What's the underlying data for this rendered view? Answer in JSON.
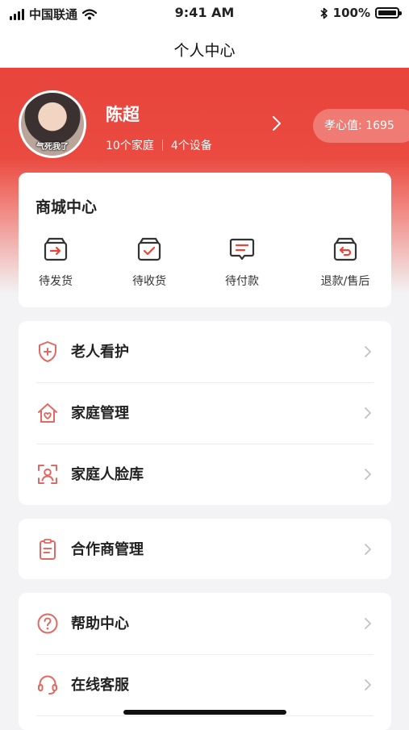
{
  "status_bar": {
    "carrier": "中国联通",
    "time": "9:41 AM",
    "battery": "100%"
  },
  "nav": {
    "title": "个人中心"
  },
  "profile": {
    "name": "陈超",
    "families": "10个家庭",
    "devices": "4个设备",
    "avatar_caption": "气死我了",
    "filial_value": "孝心值: 1695"
  },
  "mall": {
    "title": "商城中心",
    "orders": [
      {
        "label": "待发货",
        "icon": "box-arrow-icon"
      },
      {
        "label": "待收货",
        "icon": "box-check-icon"
      },
      {
        "label": "待付款",
        "icon": "chat-lines-icon"
      },
      {
        "label": "退款/售后",
        "icon": "box-return-icon"
      }
    ]
  },
  "menu_group_1": [
    {
      "label": "老人看护",
      "icon": "shield-plus-icon"
    },
    {
      "label": "家庭管理",
      "icon": "house-heart-icon"
    },
    {
      "label": "家庭人脸库",
      "icon": "face-scan-icon"
    }
  ],
  "menu_group_2": [
    {
      "label": "合作商管理",
      "icon": "clipboard-icon"
    }
  ],
  "menu_group_3": [
    {
      "label": "帮助中心",
      "icon": "help-circle-icon"
    },
    {
      "label": "在线客服",
      "icon": "headset-icon"
    }
  ],
  "colors": {
    "brand_red": "#e8453c",
    "icon_red": "#e06a63"
  }
}
